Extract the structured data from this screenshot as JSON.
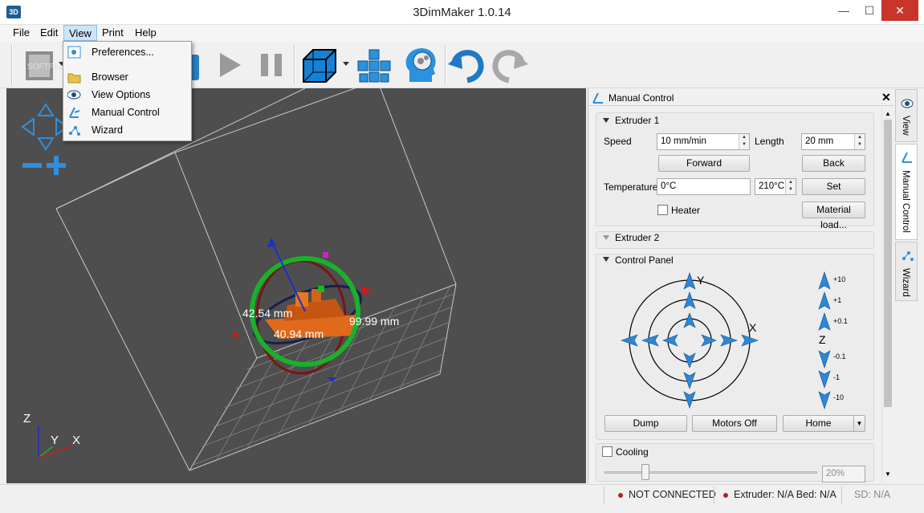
{
  "window": {
    "title": "3DimMaker 1.0.14",
    "app_icon_text": "3D",
    "minimize": "—",
    "maximize": "☐",
    "close": "✕"
  },
  "menubar": [
    "File",
    "Edit",
    "View",
    "Print",
    "Help"
  ],
  "view_menu": [
    "Preferences...",
    "Browser",
    "View Options",
    "Manual Control",
    "Wizard"
  ],
  "viewport": {
    "measure_x": "42.54 mm",
    "measure_y": "40.94 mm",
    "measure_z": "99.99 mm",
    "axis_z": "Z",
    "axis_y": "Y",
    "axis_x": "X",
    "watermark": "SOFTPEDIA"
  },
  "panel": {
    "title": "Manual Control",
    "extruder1": {
      "title": "Extruder 1",
      "speed_label": "Speed",
      "speed_value": "10 mm/min",
      "length_label": "Length",
      "length_value": "20 mm",
      "forward": "Forward",
      "back": "Back",
      "temperature_label": "Temperature",
      "temperature_value": "0°C",
      "temp_target": "210°C",
      "set": "Set",
      "heater": "Heater",
      "material_load": "Material load..."
    },
    "extruder2": {
      "title": "Extruder 2"
    },
    "control_panel": {
      "title": "Control Panel",
      "y_label": "Y",
      "x_label": "X",
      "z_label": "Z",
      "z_steps": [
        "+10",
        "+1",
        "+0.1",
        "-0.1",
        "-1",
        "-10"
      ],
      "dump": "Dump",
      "motors_off": "Motors Off",
      "home": "Home"
    },
    "cooling": {
      "label": "Cooling",
      "value": "20%",
      "level_percent": 20
    }
  },
  "side_tabs": [
    "View",
    "Manual Control",
    "Wizard"
  ],
  "status": {
    "connection": "NOT CONNECTED",
    "temps": "Extruder: N/A Bed: N/A",
    "sd": "SD: N/A"
  },
  "colors": {
    "accent": "#2f8fdc",
    "rotation_ring": "#19b12a",
    "model": "#e0691c"
  }
}
